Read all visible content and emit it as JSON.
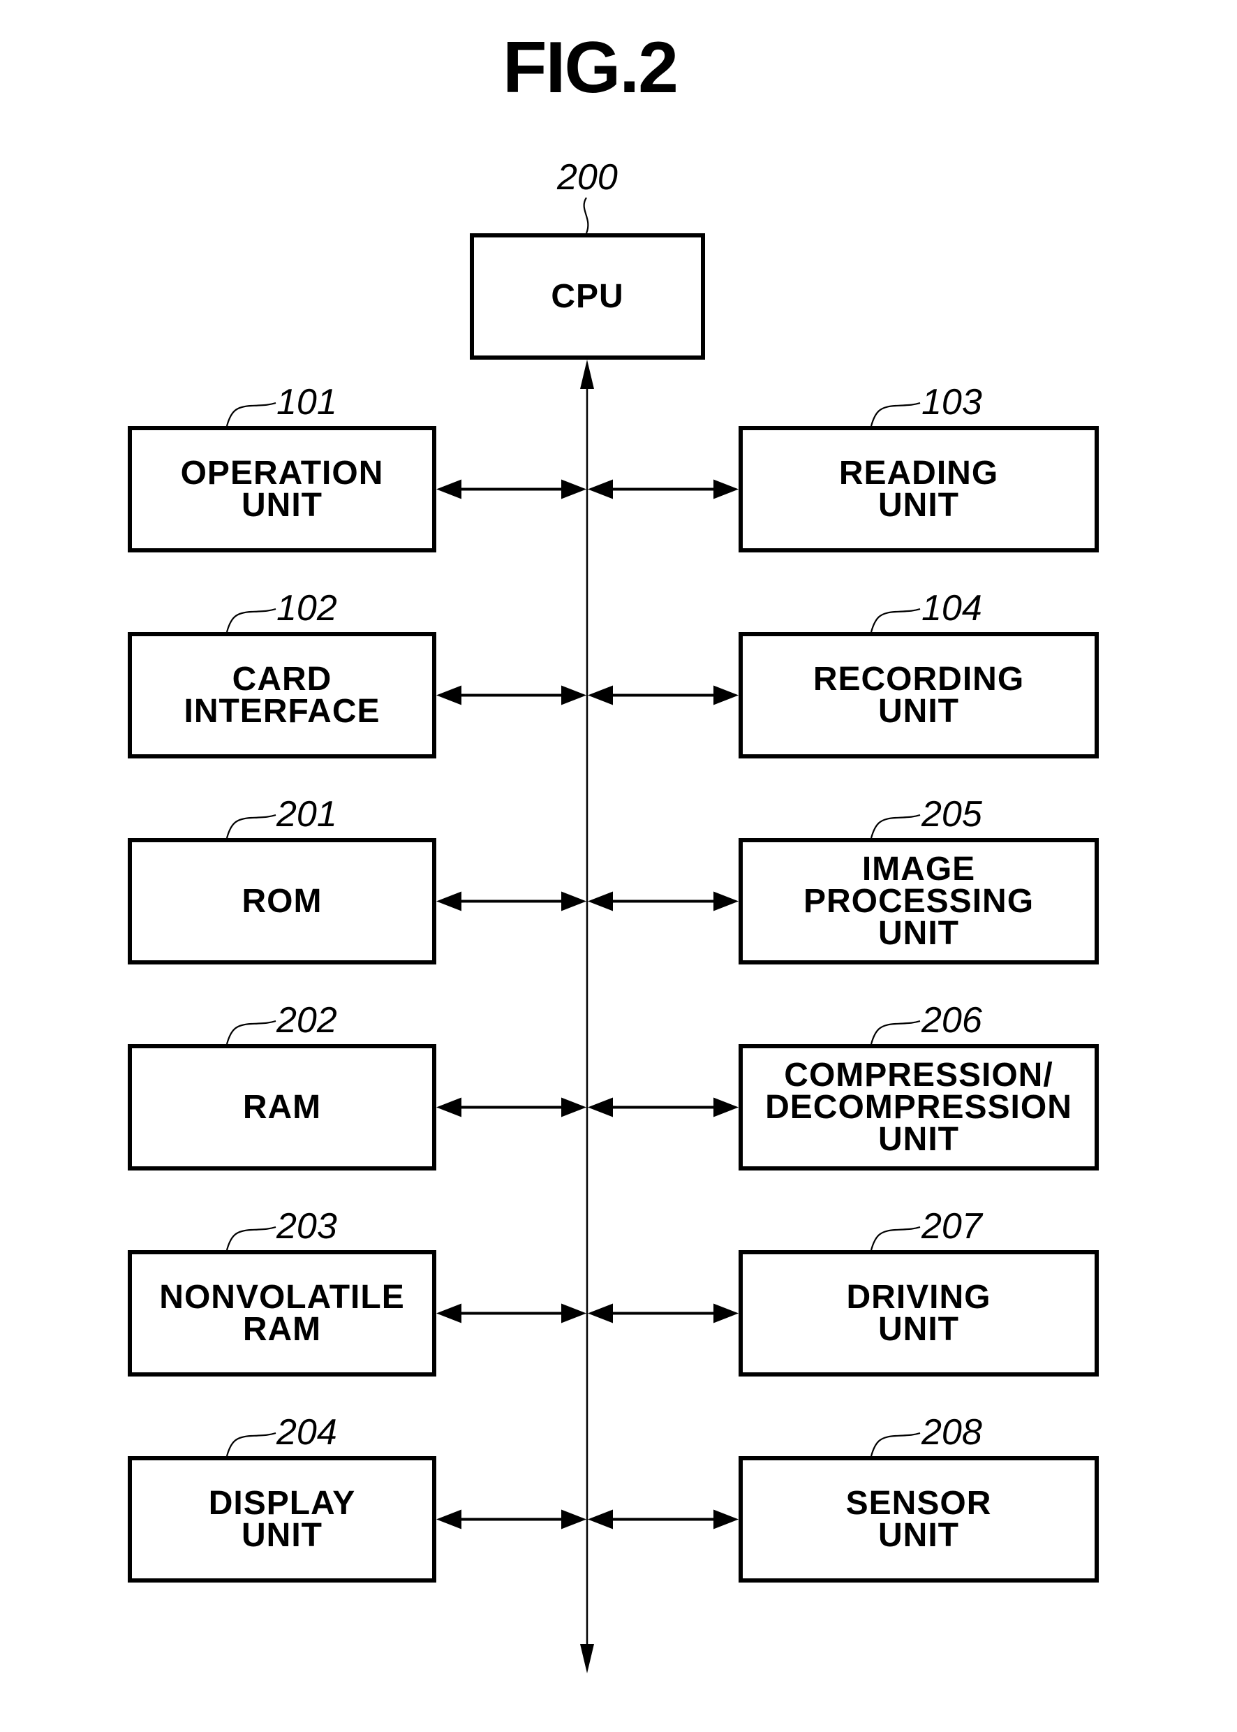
{
  "figure": {
    "title": "FIG.2"
  },
  "cpu": {
    "ref": "200",
    "label": "CPU"
  },
  "bus": {
    "direction": "bidirectional-vertical"
  },
  "left_column": [
    {
      "ref": "101",
      "label": "OPERATION\nUNIT"
    },
    {
      "ref": "102",
      "label": "CARD\nINTERFACE"
    },
    {
      "ref": "201",
      "label": "ROM"
    },
    {
      "ref": "202",
      "label": "RAM"
    },
    {
      "ref": "203",
      "label": "NONVOLATILE\nRAM"
    },
    {
      "ref": "204",
      "label": "DISPLAY\nUNIT"
    }
  ],
  "right_column": [
    {
      "ref": "103",
      "label": "READING\nUNIT"
    },
    {
      "ref": "104",
      "label": "RECORDING\nUNIT"
    },
    {
      "ref": "205",
      "label": "IMAGE\nPROCESSING\nUNIT"
    },
    {
      "ref": "206",
      "label": "COMPRESSION/\nDECOMPRESSION\nUNIT"
    },
    {
      "ref": "207",
      "label": "DRIVING\nUNIT"
    },
    {
      "ref": "208",
      "label": "SENSOR\nUNIT"
    }
  ]
}
